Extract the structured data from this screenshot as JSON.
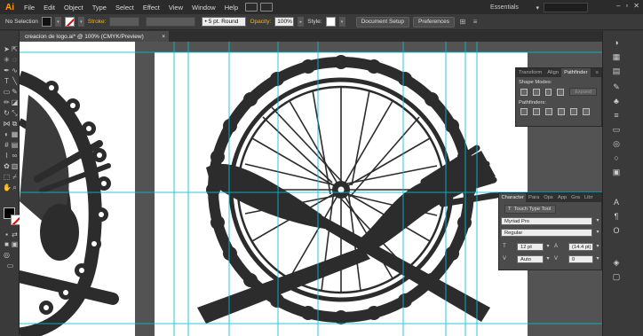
{
  "app": {
    "logo": "Ai",
    "menu": [
      "File",
      "Edit",
      "Object",
      "Type",
      "Select",
      "Effect",
      "View",
      "Window",
      "Help"
    ],
    "workspace": "Essentials"
  },
  "control_bar": {
    "selection": "No Selection",
    "stroke_label": "Stroke:",
    "brush": "5 pt. Round",
    "opacity_label": "Opacity:",
    "opacity_value": "100%",
    "style_label": "Style:",
    "document_setup": "Document Setup",
    "preferences": "Preferences"
  },
  "document_tab": {
    "title": "creacion de logo.ai* @ 100% (CMYK/Preview)",
    "close": "×"
  },
  "pathfinder_panel": {
    "tabs": [
      "Transform",
      "Align",
      "Pathfinder"
    ],
    "active_tab": "Pathfinder",
    "shape_modes_label": "Shape Modes:",
    "pathfinders_label": "Pathfinders:",
    "expand_label": "Expand"
  },
  "character_panel": {
    "tabs": [
      "Character",
      "Para",
      "Ops",
      "App",
      "Gra",
      "Libr"
    ],
    "touch_type_label": "Touch Type Tool",
    "font_family": "Myriad Pro",
    "font_style": "Regular",
    "font_size": "12 pt",
    "leading": "(14.4 pt)",
    "kerning": "Auto",
    "tracking": "0"
  },
  "colors": {
    "fill": "#000000",
    "stroke": "none",
    "artwork": "#2c2c2c",
    "guides": "#00c2d4"
  }
}
